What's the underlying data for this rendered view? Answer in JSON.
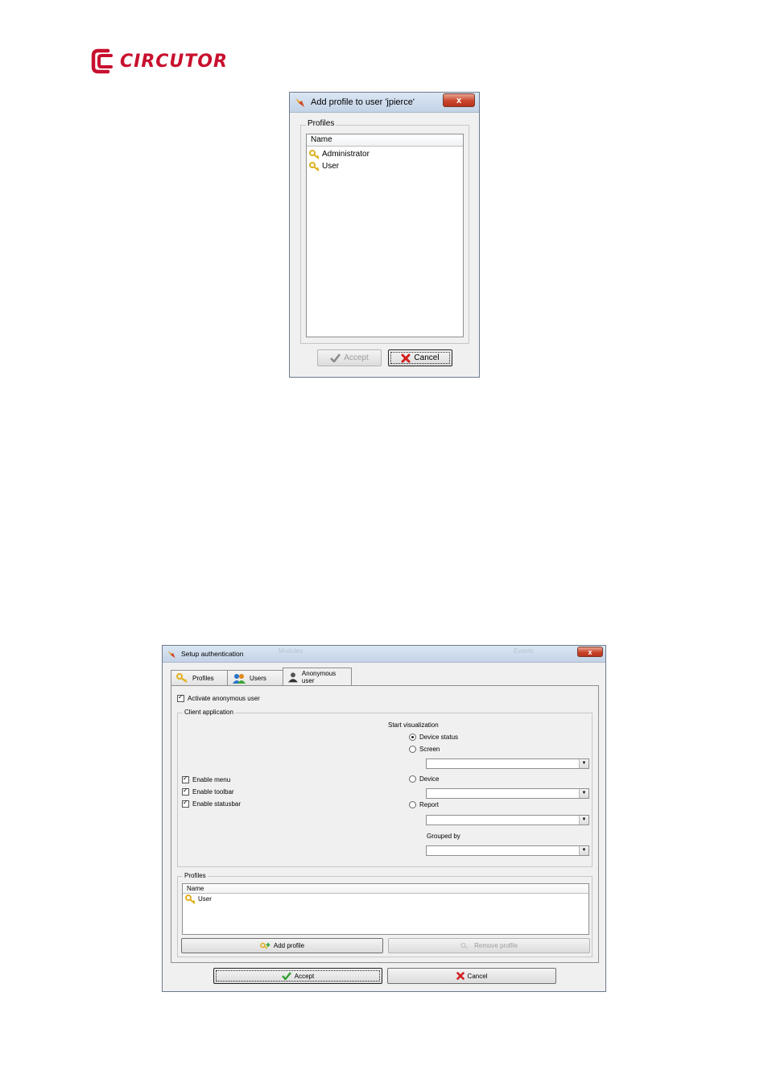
{
  "logo": {
    "brand_text": "CIRCUTOR",
    "brand_color": "#c8102e"
  },
  "dialog_add_profile": {
    "title": "Add profile to user 'jpierce'",
    "close_label": "x",
    "profiles_group_label": "Profiles",
    "column_name": "Name",
    "items": [
      {
        "label": "Administrator",
        "icon": "key-icon"
      },
      {
        "label": "User",
        "icon": "key-icon"
      }
    ],
    "accept_label": "Accept",
    "cancel_label": "Cancel"
  },
  "dialog_setup_auth": {
    "title": "Setup authentication",
    "close_label": "x",
    "background_labels": [
      "Modules",
      "Events"
    ],
    "tabs": [
      {
        "label": "Profiles",
        "icon": "keys-icon"
      },
      {
        "label": "Users",
        "icon": "users-icon"
      },
      {
        "label": "Anonymous user",
        "icon": "anonymous-user-icon",
        "active": true
      }
    ],
    "activate_anonymous_label": "Activate anonymous user",
    "client_app_group_label": "Client application",
    "enable_menu_label": "Enable menu",
    "enable_toolbar_label": "Enable toolbar",
    "enable_statusbar_label": "Enable statusbar",
    "start_visualization_label": "Start visualization",
    "options": {
      "device_status": "Device status",
      "screen": "Screen",
      "device": "Device",
      "report": "Report",
      "grouped_by": "Grouped by"
    },
    "profiles_group_label": "Profiles",
    "column_name": "Name",
    "profile_items": [
      {
        "label": "User"
      }
    ],
    "add_profile_label": "Add profile",
    "remove_profile_label": "Remove profile",
    "accept_label": "Accept",
    "cancel_label": "Cancel"
  },
  "colors": {
    "key_icon": "#e0b020",
    "accept_green": "#2e9e2e",
    "cancel_red": "#d21f1f"
  }
}
